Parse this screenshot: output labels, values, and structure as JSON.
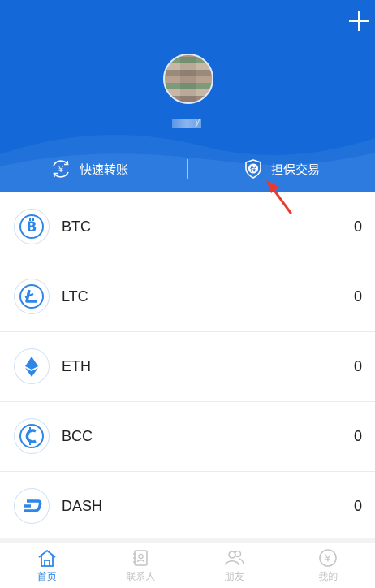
{
  "header": {
    "name_suffix": "y",
    "actions": [
      {
        "label": "快速转账",
        "icon": "transfer-yuan-icon"
      },
      {
        "label": "担保交易",
        "icon": "shield-guarantee-icon",
        "icon_text": "保"
      }
    ]
  },
  "coins": [
    {
      "symbol": "BTC",
      "balance": "0",
      "icon": "bitcoin-icon",
      "glyph": "B"
    },
    {
      "symbol": "LTC",
      "balance": "0",
      "icon": "litecoin-icon",
      "glyph": "Ł"
    },
    {
      "symbol": "ETH",
      "balance": "0",
      "icon": "ethereum-icon",
      "glyph": ""
    },
    {
      "symbol": "BCC",
      "balance": "0",
      "icon": "bitcoin-cash-icon",
      "glyph": "C"
    },
    {
      "symbol": "DASH",
      "balance": "0",
      "icon": "dash-icon",
      "glyph": "D"
    }
  ],
  "tabs": [
    {
      "label": "首页",
      "icon": "home-icon",
      "active": true
    },
    {
      "label": "联系人",
      "icon": "contacts-icon",
      "active": false
    },
    {
      "label": "朋友",
      "icon": "friends-icon",
      "active": false
    },
    {
      "label": "我的",
      "icon": "wallet-yuan-icon",
      "active": false
    }
  ],
  "colors": {
    "header_blue": "#1468d8",
    "accent_blue": "#2e86e6",
    "pointer_red": "#e8392f"
  }
}
